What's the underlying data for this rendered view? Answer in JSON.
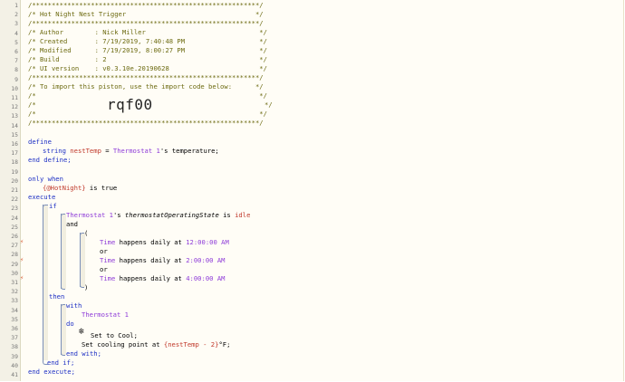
{
  "line_numbers": [
    "1",
    "2",
    "3",
    "4",
    "5",
    "6",
    "7",
    "8",
    "9",
    "10",
    "11",
    "12",
    "13",
    "14",
    "15",
    "16",
    "17",
    "18",
    "19",
    "20",
    "21",
    "22",
    "23",
    "24",
    "25",
    "26",
    "27",
    "28",
    "29",
    "30",
    "31",
    "32",
    "33",
    "34",
    "35",
    "36",
    "37",
    "38",
    "39",
    "40",
    "41"
  ],
  "header": {
    "l1": "/**********************************************************/",
    "l2": "/* Hot Night Nest Trigger                                 */",
    "l3": "/**********************************************************/",
    "l4": "/* Author        : Nick Miller                             */",
    "l5": "/* Created       : 7/19/2019, 7:40:48 PM                   */",
    "l6": "/* Modified      : 7/19/2019, 8:00:27 PM                   */",
    "l7": "/* Build         : 2                                       */",
    "l8": "/* UI version    : v0.3.10e.20190628                       */",
    "l9": "/**********************************************************/",
    "l10": "/* To import this piston, use the import code below:      */",
    "l11": "/*                                                         */",
    "l12a": "/*",
    "l12b": "rqf00",
    "l12c": "*/",
    "l13": "/*                                                         */",
    "l14": "/**********************************************************/"
  },
  "code": {
    "define": "define",
    "string": "string",
    "nestTemp": "nestTemp",
    "eq": " = ",
    "thermostat_dev": "Thermostat 1",
    "temperature": "'s temperature;",
    "end_define": "end define;",
    "only_when": "only when",
    "hotnight": "{@HotNight}",
    "is_true": " is true",
    "execute": "execute",
    "if": "if",
    "t1_dev": "Thermostat 1",
    "t1_attr_pre": "'s ",
    "t1_attr": "thermostatOperatingState",
    "t1_is": " is ",
    "t1_val": "idle",
    "and": "and",
    "paren_open": "(",
    "time1_a": "Time",
    "time1_b": " happens daily at ",
    "time1_c": "12:00:00 AM",
    "or1": "or",
    "time2_a": "Time",
    "time2_b": " happens daily at ",
    "time2_c": "2:00:00 AM",
    "or2": "or",
    "time3_a": "Time",
    "time3_b": " happens daily at ",
    "time3_c": "4:00:00 AM",
    "paren_close": ")",
    "then": "then",
    "with": "with",
    "with_dev": "Thermostat 1",
    "do": "do",
    "snow": "❄",
    "set_cool": "Set to Cool;",
    "set_point_a": "Set cooling point at ",
    "set_point_b": "{nestTemp - 2}",
    "set_point_c": "°F;",
    "end_with": "end with;",
    "end_if": "end if;",
    "end_execute": "end execute;"
  },
  "markers": {
    "trigger_icon": "lightning-icon",
    "marker_color": "#d6532a"
  }
}
